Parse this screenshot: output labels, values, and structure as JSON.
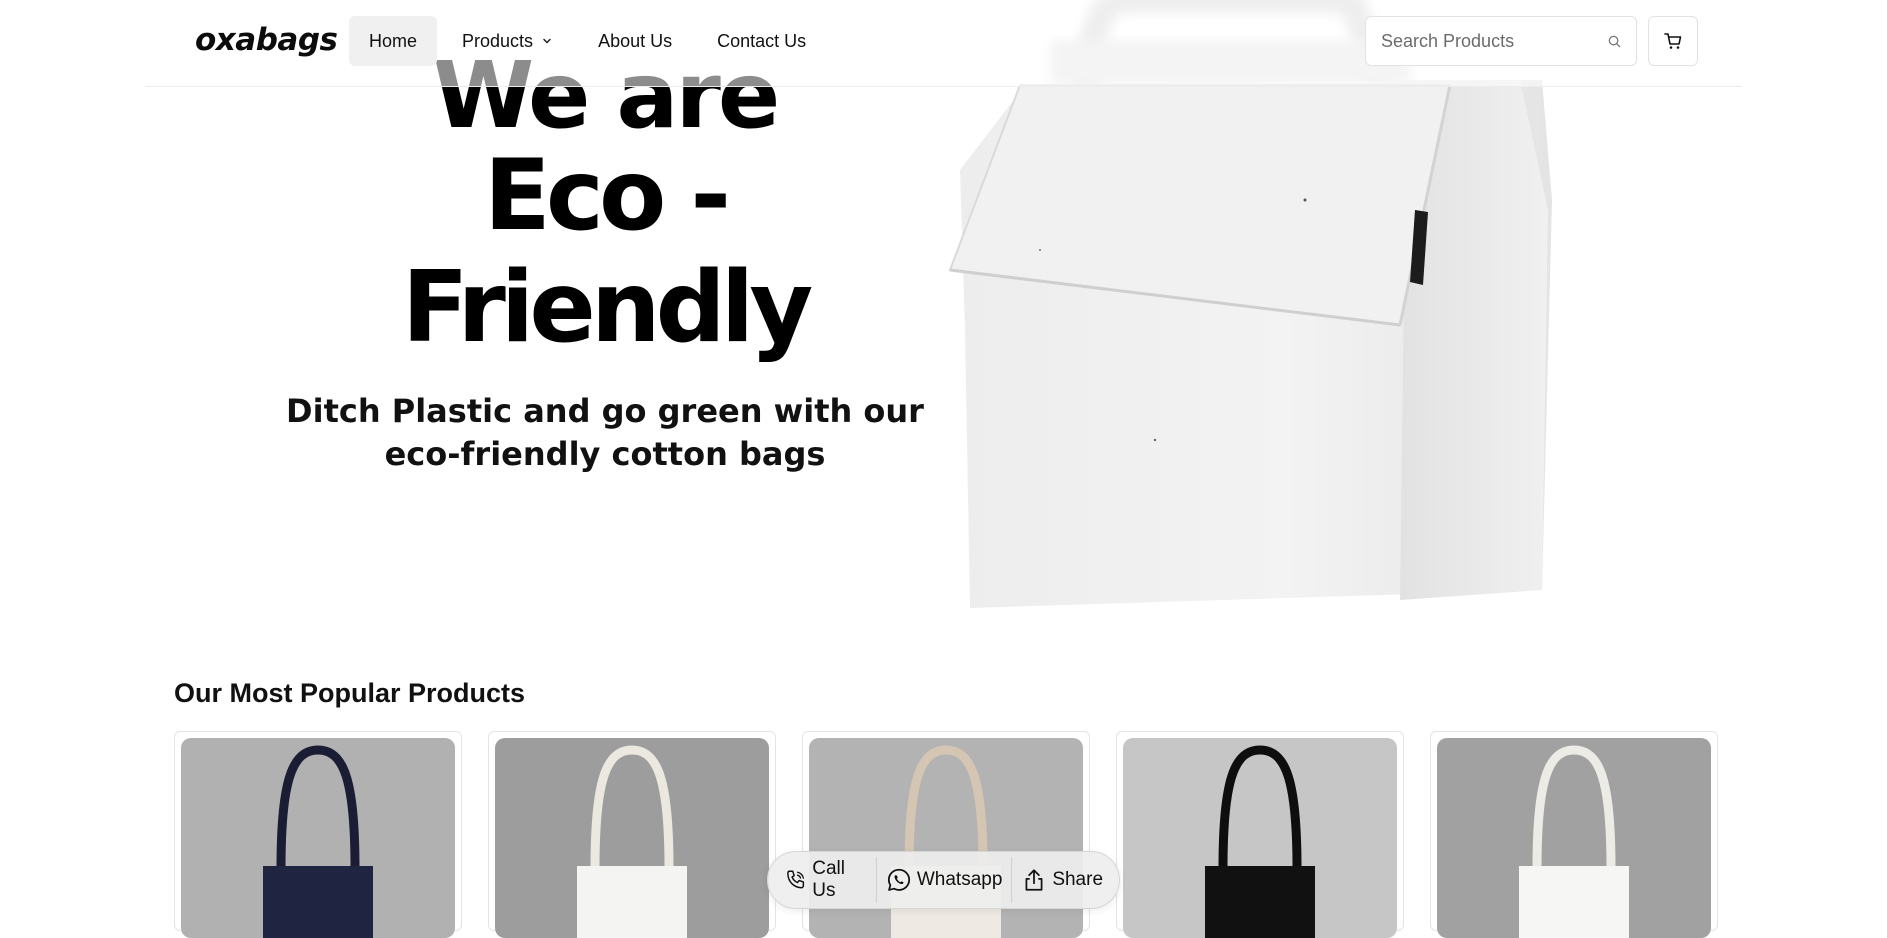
{
  "brand": {
    "logo_text": "oxabags"
  },
  "nav": {
    "items": [
      {
        "label": "Home",
        "active": true
      },
      {
        "label": "Products",
        "has_dropdown": true
      },
      {
        "label": "About Us"
      },
      {
        "label": "Contact Us"
      }
    ]
  },
  "search": {
    "placeholder": "Search Products",
    "value": ""
  },
  "hero": {
    "line1": "We are",
    "line2": "Eco - Friendly",
    "subtitle_line1": "Ditch Plastic and go green with our",
    "subtitle_line2": "eco-friendly cotton bags"
  },
  "popular": {
    "title": "Our Most Popular Products",
    "products": [
      {
        "bag_color": "#1f2440",
        "bg": "#b1b1b1",
        "handle": "#1a1d33"
      },
      {
        "bag_color": "#f4f4f2",
        "bg": "#9d9d9d",
        "handle": "#ebe8e0"
      },
      {
        "bag_color": "#eeeae3",
        "bg": "#b3b3b3",
        "handle": "#d4c6b2"
      },
      {
        "bag_color": "#111111",
        "bg": "#c6c6c6",
        "handle": "#0e0e0e"
      },
      {
        "bag_color": "#f6f6f4",
        "bg": "#a1a1a1",
        "handle": "#ecebe6"
      }
    ]
  },
  "actions": {
    "call_label": "Call Us",
    "whatsapp_label": "Whatsapp",
    "share_label": "Share"
  },
  "colors": {
    "accent": "#000000",
    "nav_active_bg": "#f0f0f0",
    "border": "#e2e2e2"
  }
}
